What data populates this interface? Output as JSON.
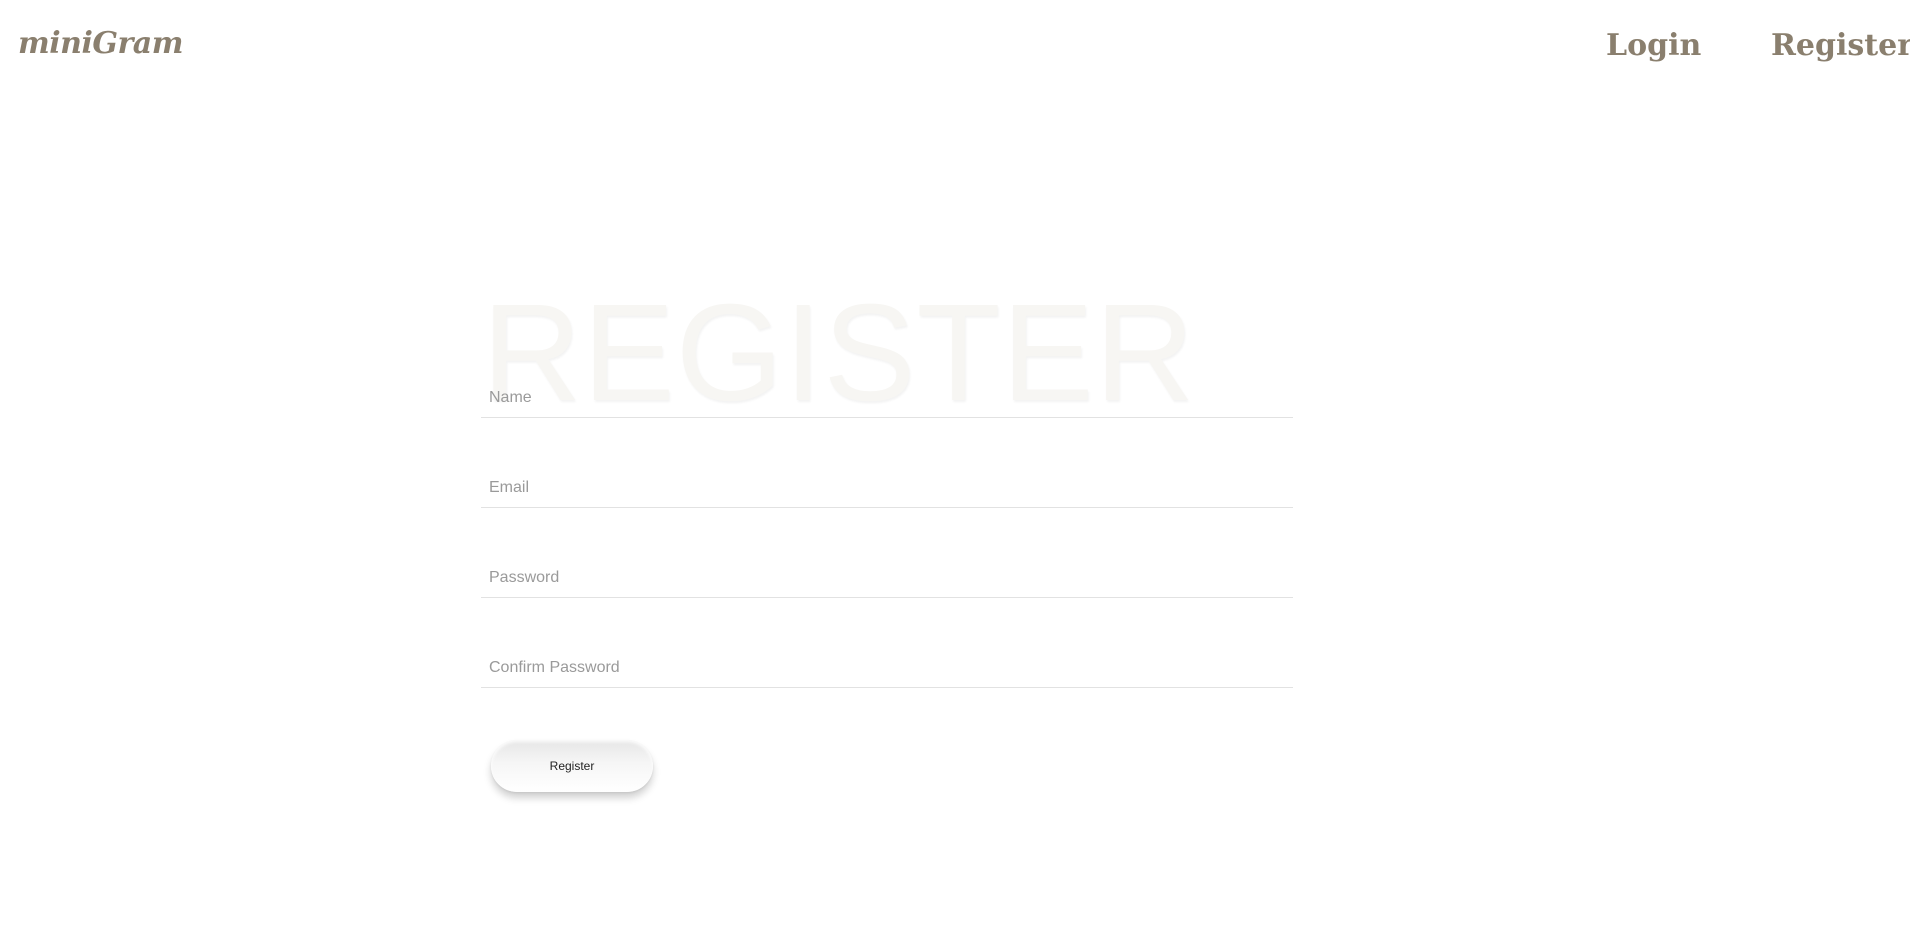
{
  "navbar": {
    "logo": "miniGram",
    "links": {
      "login": "Login",
      "register": "Register"
    }
  },
  "form": {
    "heading": "REGISTER",
    "fields": {
      "name": {
        "placeholder": "Name",
        "value": ""
      },
      "email": {
        "placeholder": "Email",
        "value": ""
      },
      "password": {
        "placeholder": "Password",
        "value": ""
      },
      "confirm_password": {
        "placeholder": "Confirm Password",
        "value": ""
      }
    },
    "submit_label": "Register"
  },
  "colors": {
    "brand": "#8a7f6e",
    "heading": "#f7f6f3",
    "placeholder": "#9a9a9a",
    "underline": "#e2e2e2"
  }
}
